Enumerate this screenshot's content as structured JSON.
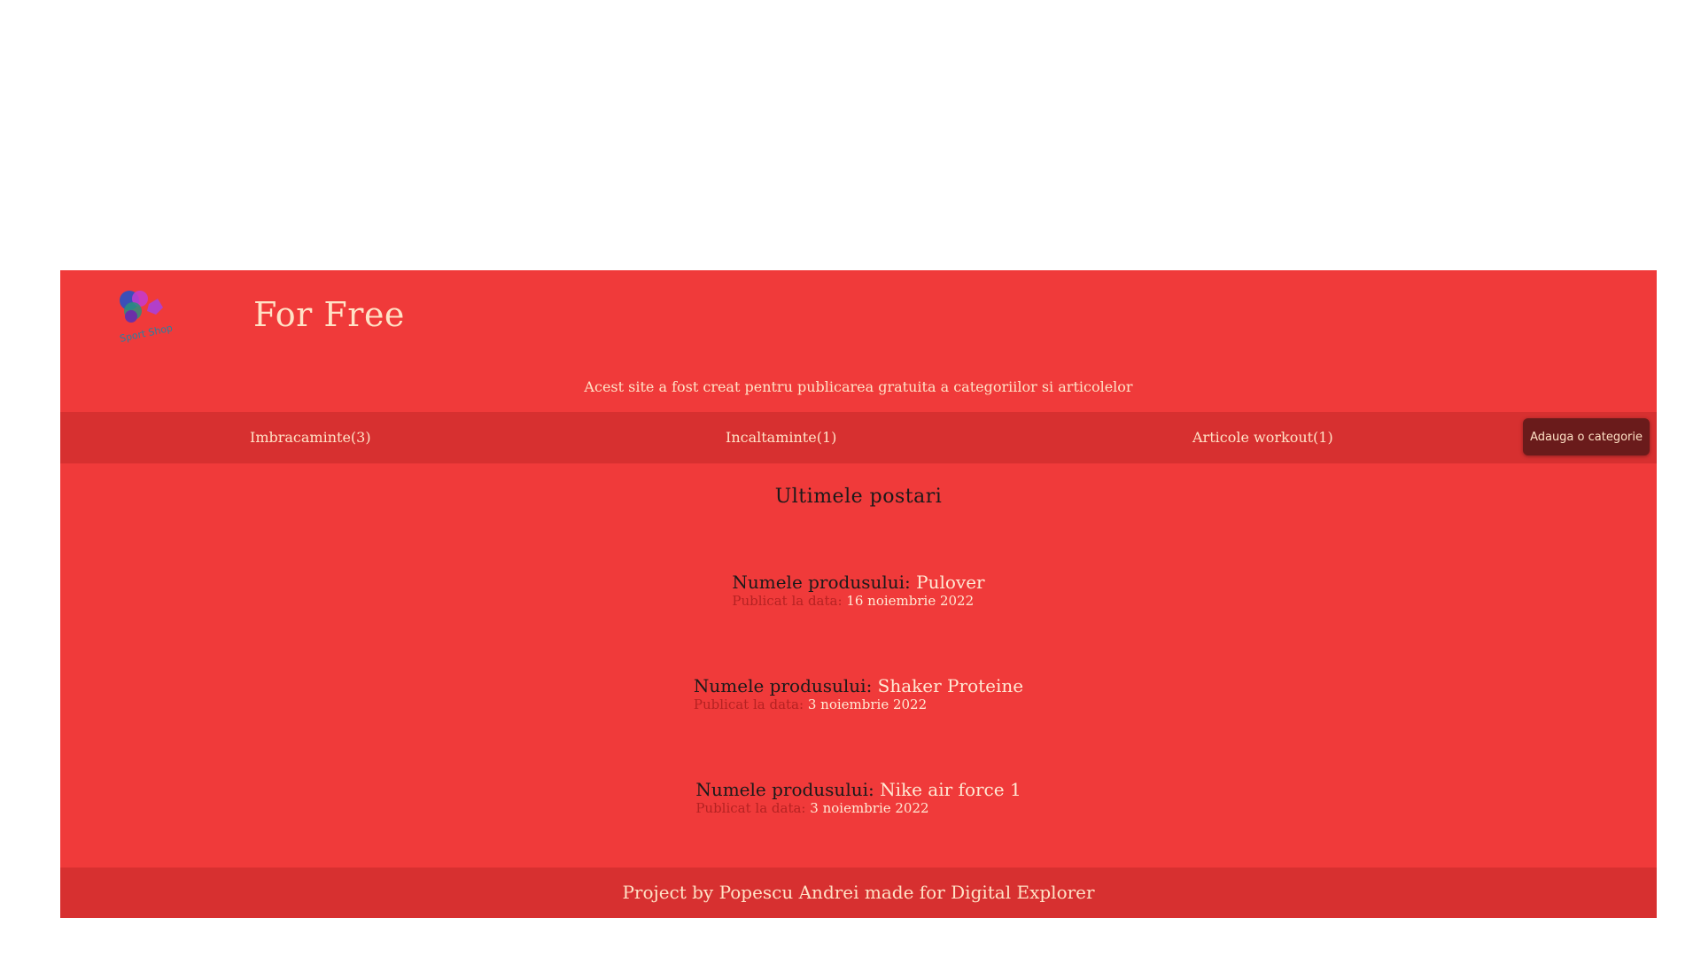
{
  "header": {
    "title": "For Free",
    "subtitle": "Acest site a fost creat pentru publicarea gratuita a categoriilor si articolelor",
    "logo_text": "Sport Shop"
  },
  "nav": {
    "items": [
      {
        "label": "Imbracaminte(3)"
      },
      {
        "label": "Incaltaminte(1)"
      },
      {
        "label": "Articole workout(1)"
      }
    ],
    "add_button": "Adauga o categorie"
  },
  "main": {
    "section_title": "Ultimele postari",
    "name_prefix": "Numele produsului:",
    "date_prefix": "Publicat la data:",
    "posts": [
      {
        "name": "Pulover",
        "date": "16 noiembrie 2022"
      },
      {
        "name": "Shaker Proteine",
        "date": "3 noiembrie 2022"
      },
      {
        "name": "Nike air force 1",
        "date": "3 noiembrie 2022"
      }
    ]
  },
  "footer": {
    "text": "Project by Popescu Andrei made for Digital Explorer"
  },
  "colors": {
    "background": "#f03a3a",
    "nav_bar": "#d73030",
    "button": "#6a1b1b",
    "light_text": "#ffe2c6"
  }
}
